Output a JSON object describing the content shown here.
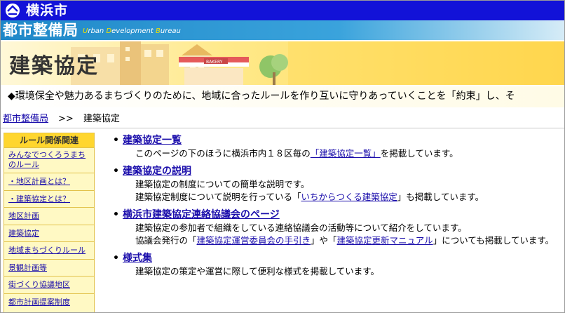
{
  "header": {
    "city_name": "横浜市",
    "bureau_name": "都市整備局",
    "bureau_en_parts": [
      "U",
      "rban ",
      "D",
      "evelopment ",
      "B",
      "ureau"
    ]
  },
  "banner": {
    "title": "建築協定",
    "shop_sign": "BAKERY"
  },
  "lead": "◆環境保全や魅力あるまちづくりのために、地域に合ったルールを作り互いに守りあっていくことを「約束」し、そ",
  "breadcrumb": {
    "home": "都市整備局",
    "sep": ">>",
    "current": "建築協定"
  },
  "sidebar": {
    "heading": "ルール関係関連",
    "items": [
      {
        "label": "みんなでつくろうまちのルール"
      },
      {
        "label": "・地区計画とは？"
      },
      {
        "label": "・建築協定とは？"
      },
      {
        "label": "地区計画"
      },
      {
        "label": "建築協定"
      },
      {
        "label": "地域まちづくりルール"
      },
      {
        "label": "景観計画等"
      },
      {
        "label": "街づくり協議地区"
      },
      {
        "label": "都市計画提案制度"
      }
    ]
  },
  "sections": [
    {
      "title": "建築協定一覧",
      "line1_pre": "このページの下のほうに横浜市内１８区毎の",
      "line1_link": "「建築協定一覧」",
      "line1_post": "を掲載しています。"
    },
    {
      "title": "建築協定の説明",
      "line1": "建築協定の制度についての簡単な説明です。",
      "line2_pre": "建築協定制度について説明を行っている「",
      "line2_link": "いちからつくる建築協定",
      "line2_post": "」も掲載しています。"
    },
    {
      "title": "横浜市建築協定連絡協議会のページ",
      "line1": "建築協定の参加者で組織をしている連絡協議会の活動等について紹介をしています。",
      "line2_pre": "協議会発行の「",
      "line2_link1": "建築協定運営委員会の手引き",
      "line2_mid": "」や「",
      "line2_link2": "建築協定更新マニュアル",
      "line2_post": "」についても掲載しています。"
    },
    {
      "title": "様式集",
      "line1": "建築協定の策定や運営に際して便利な様式を掲載しています。"
    }
  ],
  "colors": {
    "city_bar": "#1212d8",
    "bureau_bar": "#1f88c8",
    "banner": "#ffd64d",
    "sidebar_head": "#ffd62e",
    "sidebar_bg": "#fff9c4",
    "link": "#1a0dab"
  }
}
